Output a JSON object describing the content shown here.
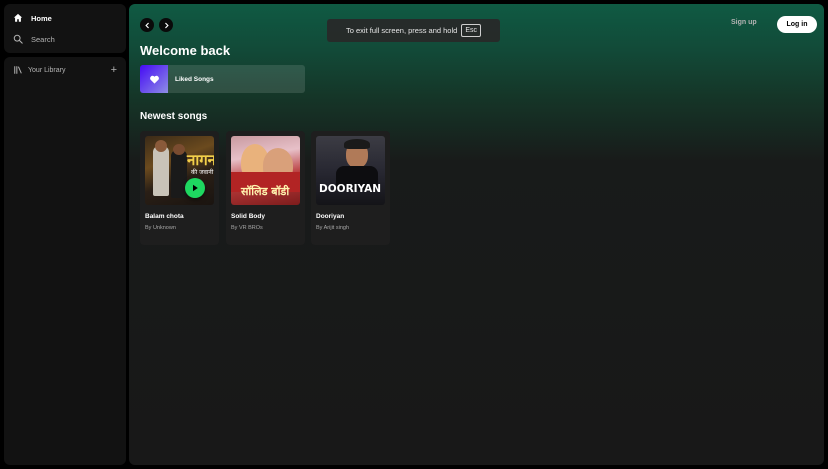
{
  "sidebar": {
    "nav": [
      {
        "label": "Home",
        "icon": "home-icon"
      },
      {
        "label": "Search",
        "icon": "search-icon"
      }
    ],
    "library": {
      "label": "Your Library",
      "icon": "library-icon",
      "add_icon": "plus-icon"
    }
  },
  "header": {
    "fullscreen_notice": {
      "text": "To exit full screen, press and hold",
      "key": "Esc"
    },
    "signup_label": "Sign up",
    "login_label": "Log in"
  },
  "main": {
    "greeting": "Welcome back",
    "liked_songs": {
      "label": "Liked Songs",
      "icon": "heart-icon"
    },
    "section_title": "Newest songs",
    "songs": [
      {
        "title": "Balam chota",
        "artist": "By Unknown",
        "cover_text": "नागन",
        "cover_sub": "की जवानी"
      },
      {
        "title": "Solid Body",
        "artist": "By VR BROs",
        "cover_text": "सॉलिड बॉडी"
      },
      {
        "title": "Dooriyan",
        "artist": "By Arijit singh",
        "cover_text": "DOORIYAN"
      }
    ]
  },
  "colors": {
    "accent_green": "#1ed760",
    "header_gradient_top": "#0f5a43",
    "background": "#121212"
  }
}
